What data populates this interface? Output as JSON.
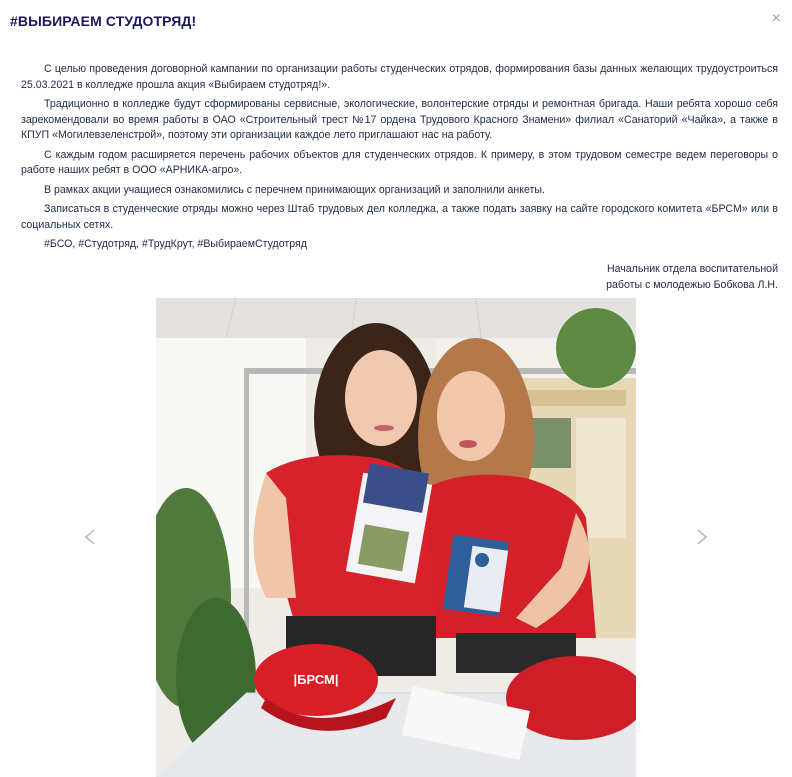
{
  "modal": {
    "title": "#ВЫБИРАЕМ СТУДОТРЯД!",
    "close_label": "×"
  },
  "article": {
    "paragraphs": [
      "С целью проведения договорной кампании по организации работы студенческих отрядов, формирования базы данных желающих трудоустроиться 25.03.2021 в колледже прошла акция «Выбираем студотряд!».",
      "Традиционно в колледже будут сформированы сервисные, экологические, волонтерские отряды и ремонтная бригада. Наши ребята хорошо себя зарекомендовали во время работы в ОАО «Строительный трест №17 ордена Трудового Красного Знамени» филиал «Санаторий «Чайка», а также в КПУП «Могилевзеленстрой», поэтому эти организации каждое лето приглашают нас на работу.",
      "С каждым годом расширяется перечень рабочих объектов для студенческих отрядов. К примеру, в этом трудовом семестре ведем переговоры о работе наших ребят в ООО «АРНИКА-агро».",
      "В рамках акции учащиеся ознакомились с перечнем принимающих организаций и заполнили анкеты.",
      "Записаться в студенческие отряды можно через Штаб трудовых дел колледжа, а также подать заявку на сайте городского комитета «БРСМ» или в социальных сетях.",
      "#БСО, #Студотряд, #ТрудКрут, #ВыбираемСтудотряд"
    ],
    "signature_line1": "Начальник отдела воспитательной",
    "signature_line2": "работы с молодежью Бобкова Л.Н."
  },
  "gallery": {
    "cap_text": "|БРСМ|",
    "icons": {
      "prev": "chevron-left-icon",
      "next": "chevron-right-icon"
    },
    "colors": {
      "shirt": "#d8222b",
      "background": "#f2f0ee"
    }
  }
}
